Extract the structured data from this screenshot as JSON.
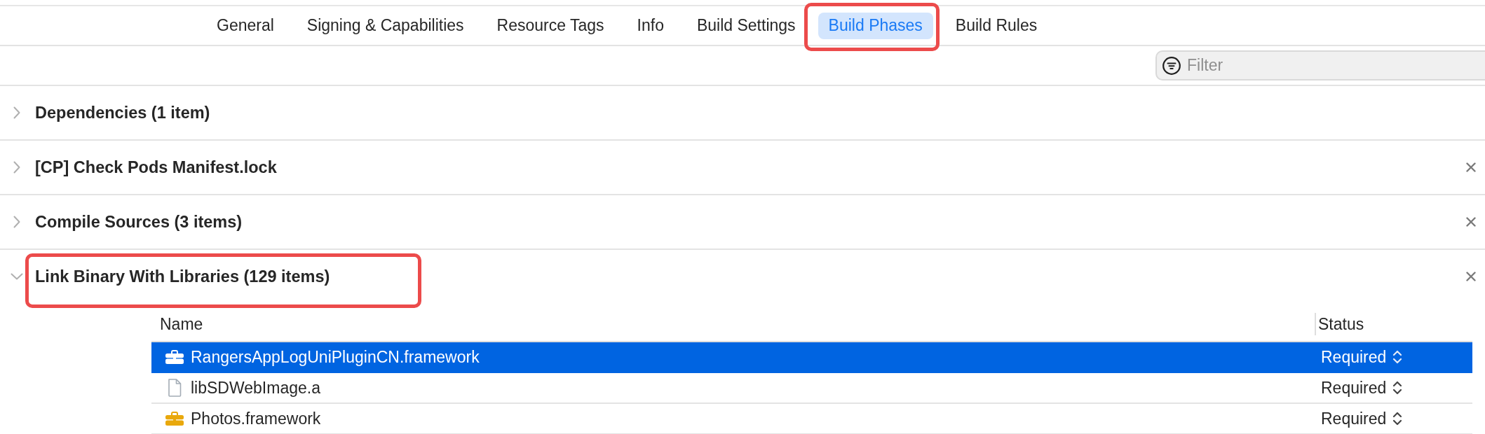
{
  "tabs": [
    {
      "label": "General",
      "selected": false,
      "highlighted": false
    },
    {
      "label": "Signing & Capabilities",
      "selected": false,
      "highlighted": false
    },
    {
      "label": "Resource Tags",
      "selected": false,
      "highlighted": false
    },
    {
      "label": "Info",
      "selected": false,
      "highlighted": false
    },
    {
      "label": "Build Settings",
      "selected": false,
      "highlighted": false
    },
    {
      "label": "Build Phases",
      "selected": true,
      "highlighted": true
    },
    {
      "label": "Build Rules",
      "selected": false,
      "highlighted": false
    }
  ],
  "filter": {
    "placeholder": "Filter"
  },
  "phases": [
    {
      "title": "Dependencies (1 item)",
      "expanded": false,
      "removable": false,
      "highlighted": false
    },
    {
      "title": "[CP] Check Pods Manifest.lock",
      "expanded": false,
      "removable": true,
      "highlighted": false
    },
    {
      "title": "Compile Sources (3 items)",
      "expanded": false,
      "removable": true,
      "highlighted": false
    },
    {
      "title": "Link Binary With Libraries (129 items)",
      "expanded": true,
      "removable": true,
      "highlighted": true,
      "table": {
        "columns": [
          "Name",
          "Status"
        ],
        "rows": [
          {
            "kind": "framework",
            "name": "RangersAppLogUniPluginCN.framework",
            "status": "Required",
            "selected": true
          },
          {
            "kind": "library",
            "name": "libSDWebImage.a",
            "status": "Required",
            "selected": false
          },
          {
            "kind": "framework",
            "name": "Photos.framework",
            "status": "Required",
            "selected": false
          }
        ]
      }
    }
  ]
}
